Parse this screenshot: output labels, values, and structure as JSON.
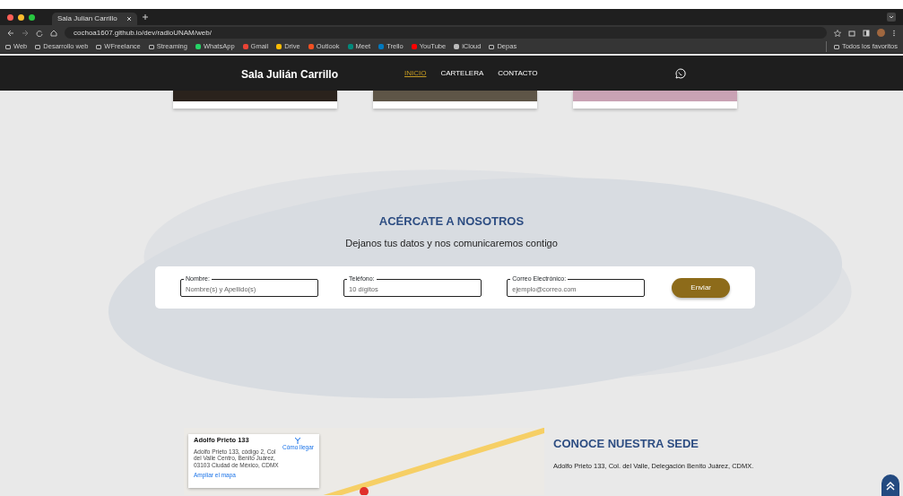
{
  "browser": {
    "tab_title": "Sala Julian Carrillo",
    "url": "cochoa1607.github.io/dev/radioUNAM/web/",
    "bookmarks": [
      {
        "label": "Web",
        "kind": "folder"
      },
      {
        "label": "Desarrollo web",
        "kind": "folder"
      },
      {
        "label": "WFreelance",
        "kind": "folder"
      },
      {
        "label": "Streaming",
        "kind": "folder"
      },
      {
        "label": "WhatsApp",
        "kind": "site",
        "color": "#25d366"
      },
      {
        "label": "Gmail",
        "kind": "site",
        "color": "#ea4335"
      },
      {
        "label": "Drive",
        "kind": "site",
        "color": "#fbbc04"
      },
      {
        "label": "Outlook",
        "kind": "site",
        "color": "#f25022"
      },
      {
        "label": "Meet",
        "kind": "site",
        "color": "#00897b"
      },
      {
        "label": "Trello",
        "kind": "site",
        "color": "#0079bf"
      },
      {
        "label": "YouTube",
        "kind": "site",
        "color": "#ff0000"
      },
      {
        "label": "iCloud",
        "kind": "site",
        "color": "#bbbbbb"
      },
      {
        "label": "Depas",
        "kind": "folder"
      }
    ],
    "all_bookmarks": "Todos los favoritos"
  },
  "navbar": {
    "brand": "Sala Julián Carrillo",
    "links": [
      {
        "label": "INICIO",
        "selected": true
      },
      {
        "label": "CARTELERA",
        "selected": false
      },
      {
        "label": "CONTACTO",
        "selected": false
      }
    ]
  },
  "contact": {
    "title": "ACÉRCATE A NOSOTROS",
    "subtitle": "Dejanos tus datos y nos comunicaremos contigo",
    "fields": [
      {
        "label": "Nombre:",
        "placeholder": "Nombre(s) y Apellido(s)"
      },
      {
        "label": "Teléfono:",
        "placeholder": "10 dígitos"
      },
      {
        "label": "Correo Electrónico:",
        "placeholder": "ejemplo@correo.com"
      }
    ],
    "submit": "Enviar"
  },
  "location": {
    "map_card": {
      "title": "Adolfo Prieto 133",
      "address": "Adolfo Prieto 133, código 2, Col del Valle Centro, Benito Juárez, 03103 Ciudad de México, CDMX",
      "directions": "Cómo llegar",
      "enlarge": "Ampliar el mapa"
    },
    "title": "CONOCE NUESTRA SEDE",
    "address": "Adolfo Prieto 133, Col. del Valle, Delegación Benito Juárez, CDMX."
  }
}
